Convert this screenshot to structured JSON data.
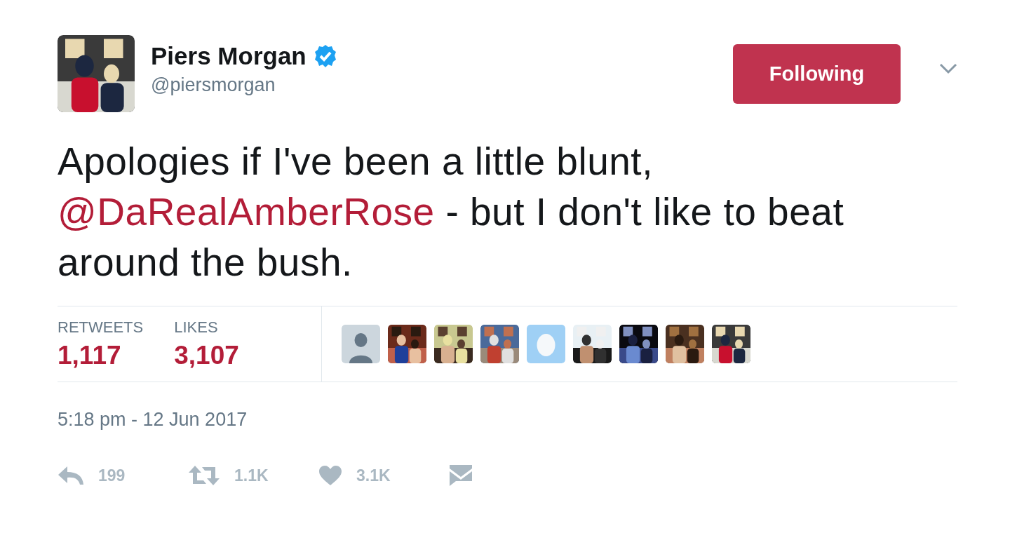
{
  "author": {
    "name": "Piers Morgan",
    "verified": true,
    "handle": "@piersmorgan",
    "avatar": {
      "kind": "picture"
    }
  },
  "follow_button": {
    "label": "Following"
  },
  "tweet": {
    "parts": [
      {
        "kind": "text",
        "text": "Apologies if I've been a little blunt, "
      },
      {
        "kind": "mention",
        "text": "@DaRealAmberRose"
      },
      {
        "kind": "text",
        "text": " - but I don't like to beat around the bush."
      }
    ]
  },
  "stats": [
    {
      "label": "RETWEETS",
      "value": "1,117"
    },
    {
      "label": "LIKES",
      "value": "3,107"
    }
  ],
  "likers": [
    {
      "kind": "default"
    },
    {
      "kind": "picture"
    },
    {
      "kind": "picture"
    },
    {
      "kind": "picture"
    },
    {
      "kind": "egg"
    },
    {
      "kind": "picture"
    },
    {
      "kind": "picture"
    },
    {
      "kind": "picture"
    },
    {
      "kind": "picture"
    }
  ],
  "timestamp": "5:18 pm - 12 Jun 2017",
  "actions": [
    {
      "kind": "reply",
      "count": "199"
    },
    {
      "kind": "retweet",
      "count": "1.1K"
    },
    {
      "kind": "like",
      "count": "3.1K"
    },
    {
      "kind": "message"
    }
  ]
}
